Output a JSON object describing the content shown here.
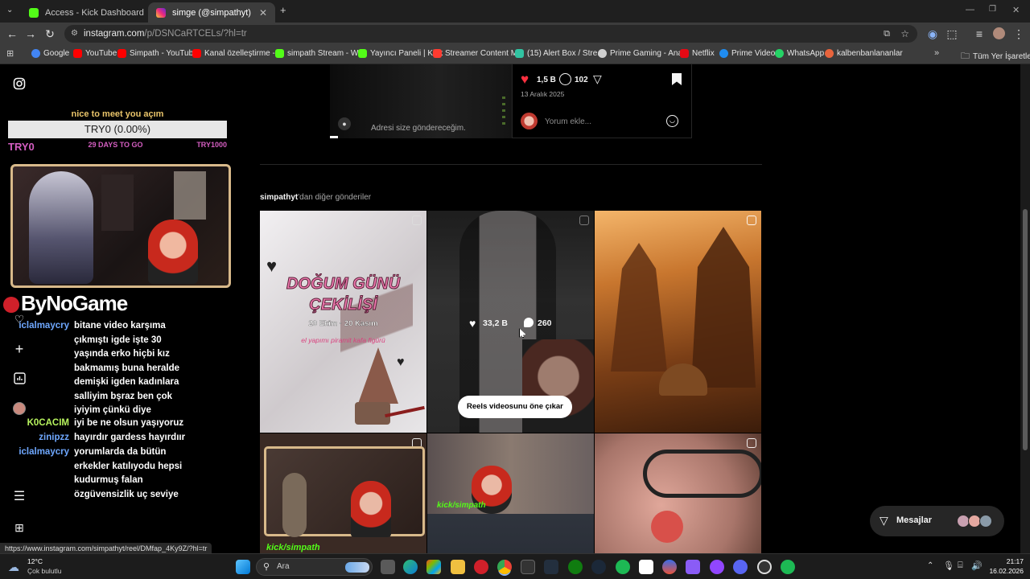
{
  "browser": {
    "tabs": [
      {
        "label": "Access - Kick Dashboard",
        "active": false,
        "color": "#53fc18"
      },
      {
        "label": "simge (@simpathyt) • Instagram",
        "active": true,
        "color": "#e1306c"
      }
    ],
    "new_tab": "+",
    "url_main": "instagram.com",
    "url_path": "/p/DSNCaRTCELs/?hl=tr",
    "bookmarks": [
      {
        "label": "Google",
        "color": "#4285f4"
      },
      {
        "label": "YouTube",
        "color": "#ff0000"
      },
      {
        "label": "Simpath - YouTube",
        "color": "#ff0000"
      },
      {
        "label": "Kanal özelleştirme -...",
        "color": "#ff0000"
      },
      {
        "label": "simpath Stream - W...",
        "color": "#53fc18"
      },
      {
        "label": "Yayıncı Paneli | Kick",
        "color": "#53fc18"
      },
      {
        "label": "Streamer Content M...",
        "color": "#ff3b30"
      },
      {
        "label": "(15) Alert Box / Stre...",
        "color": "#31c3a2"
      },
      {
        "label": "Prime Gaming - Ana...",
        "color": "#cfcfcf"
      },
      {
        "label": "Netflix",
        "color": "#e50914"
      },
      {
        "label": "Prime Video",
        "color": "#1f8cf0"
      },
      {
        "label": "WhatsApp",
        "color": "#25d366"
      },
      {
        "label": "kalbenbanlananlar",
        "color": "#e8643c"
      }
    ],
    "all_bookmarks": "Tüm Yer İşaretleri"
  },
  "overlay": {
    "goal_title": "nice to meet you açım",
    "goal_value": "TRY0 (0.00%)",
    "goal_current": "TRY0",
    "goal_days": "29 DAYS TO GO",
    "goal_target": "TRY1000",
    "logo": "ByNoGame",
    "chat": [
      {
        "user": "iclalmaycry",
        "color": "#6fa8ff",
        "message": "bitane video karşıma çıkmıştı igde işte 30 yaşında erko hiçbi kız bakmamış buna heralde demişki igden kadınlara salliyim bşraz ben çok iyiyim çünkü diye"
      },
      {
        "user": "K0CACIM",
        "color": "#b7f35e",
        "message": "iyi be ne olsun yaşıyoruz"
      },
      {
        "user": "zinipzz",
        "color": "#6fa8ff",
        "message": "hayırdır gardess hayırdıır"
      },
      {
        "user": "iclalmaycry",
        "color": "#6fa8ff",
        "message": "yorumlarda da bütün erkekler katılıyodu hepsi kudurmuş falan özgüvensizlik uç seviye"
      }
    ]
  },
  "post": {
    "likes": "1,5 B",
    "comments": "102",
    "date": "13 Aralık 2025",
    "comment_placeholder": "Yorum ekle...",
    "caption": "Adresi size göndereceğim."
  },
  "more_posts": {
    "username": "simpathyt",
    "title_suffix": "'dan diğer gönderiler",
    "items": [
      {
        "overlay_title": "DOĞUM GÜNÜ ÇEKİLİŞİ",
        "overlay_dates": "20 Ekim · 20 Kasım",
        "overlay_sub": "el yapımı piramit kafa figürü"
      },
      {
        "likes": "33,2 B",
        "comments": "260",
        "pin_label": "Reels videosunu öne çıkar"
      },
      {},
      {
        "tag": "kick/simpath"
      },
      {
        "tag": "kick/simpath"
      },
      {}
    ]
  },
  "messages_button": "Mesajlar",
  "status_url": "https://www.instagram.com/simpathyt/reel/DMfap_4Ky9Z/?hl=tr",
  "taskbar": {
    "weather_temp": "12°C",
    "weather_desc": "Çok bulutlu",
    "search": "Ara",
    "time": "21:17",
    "date": "16.02.2026"
  }
}
